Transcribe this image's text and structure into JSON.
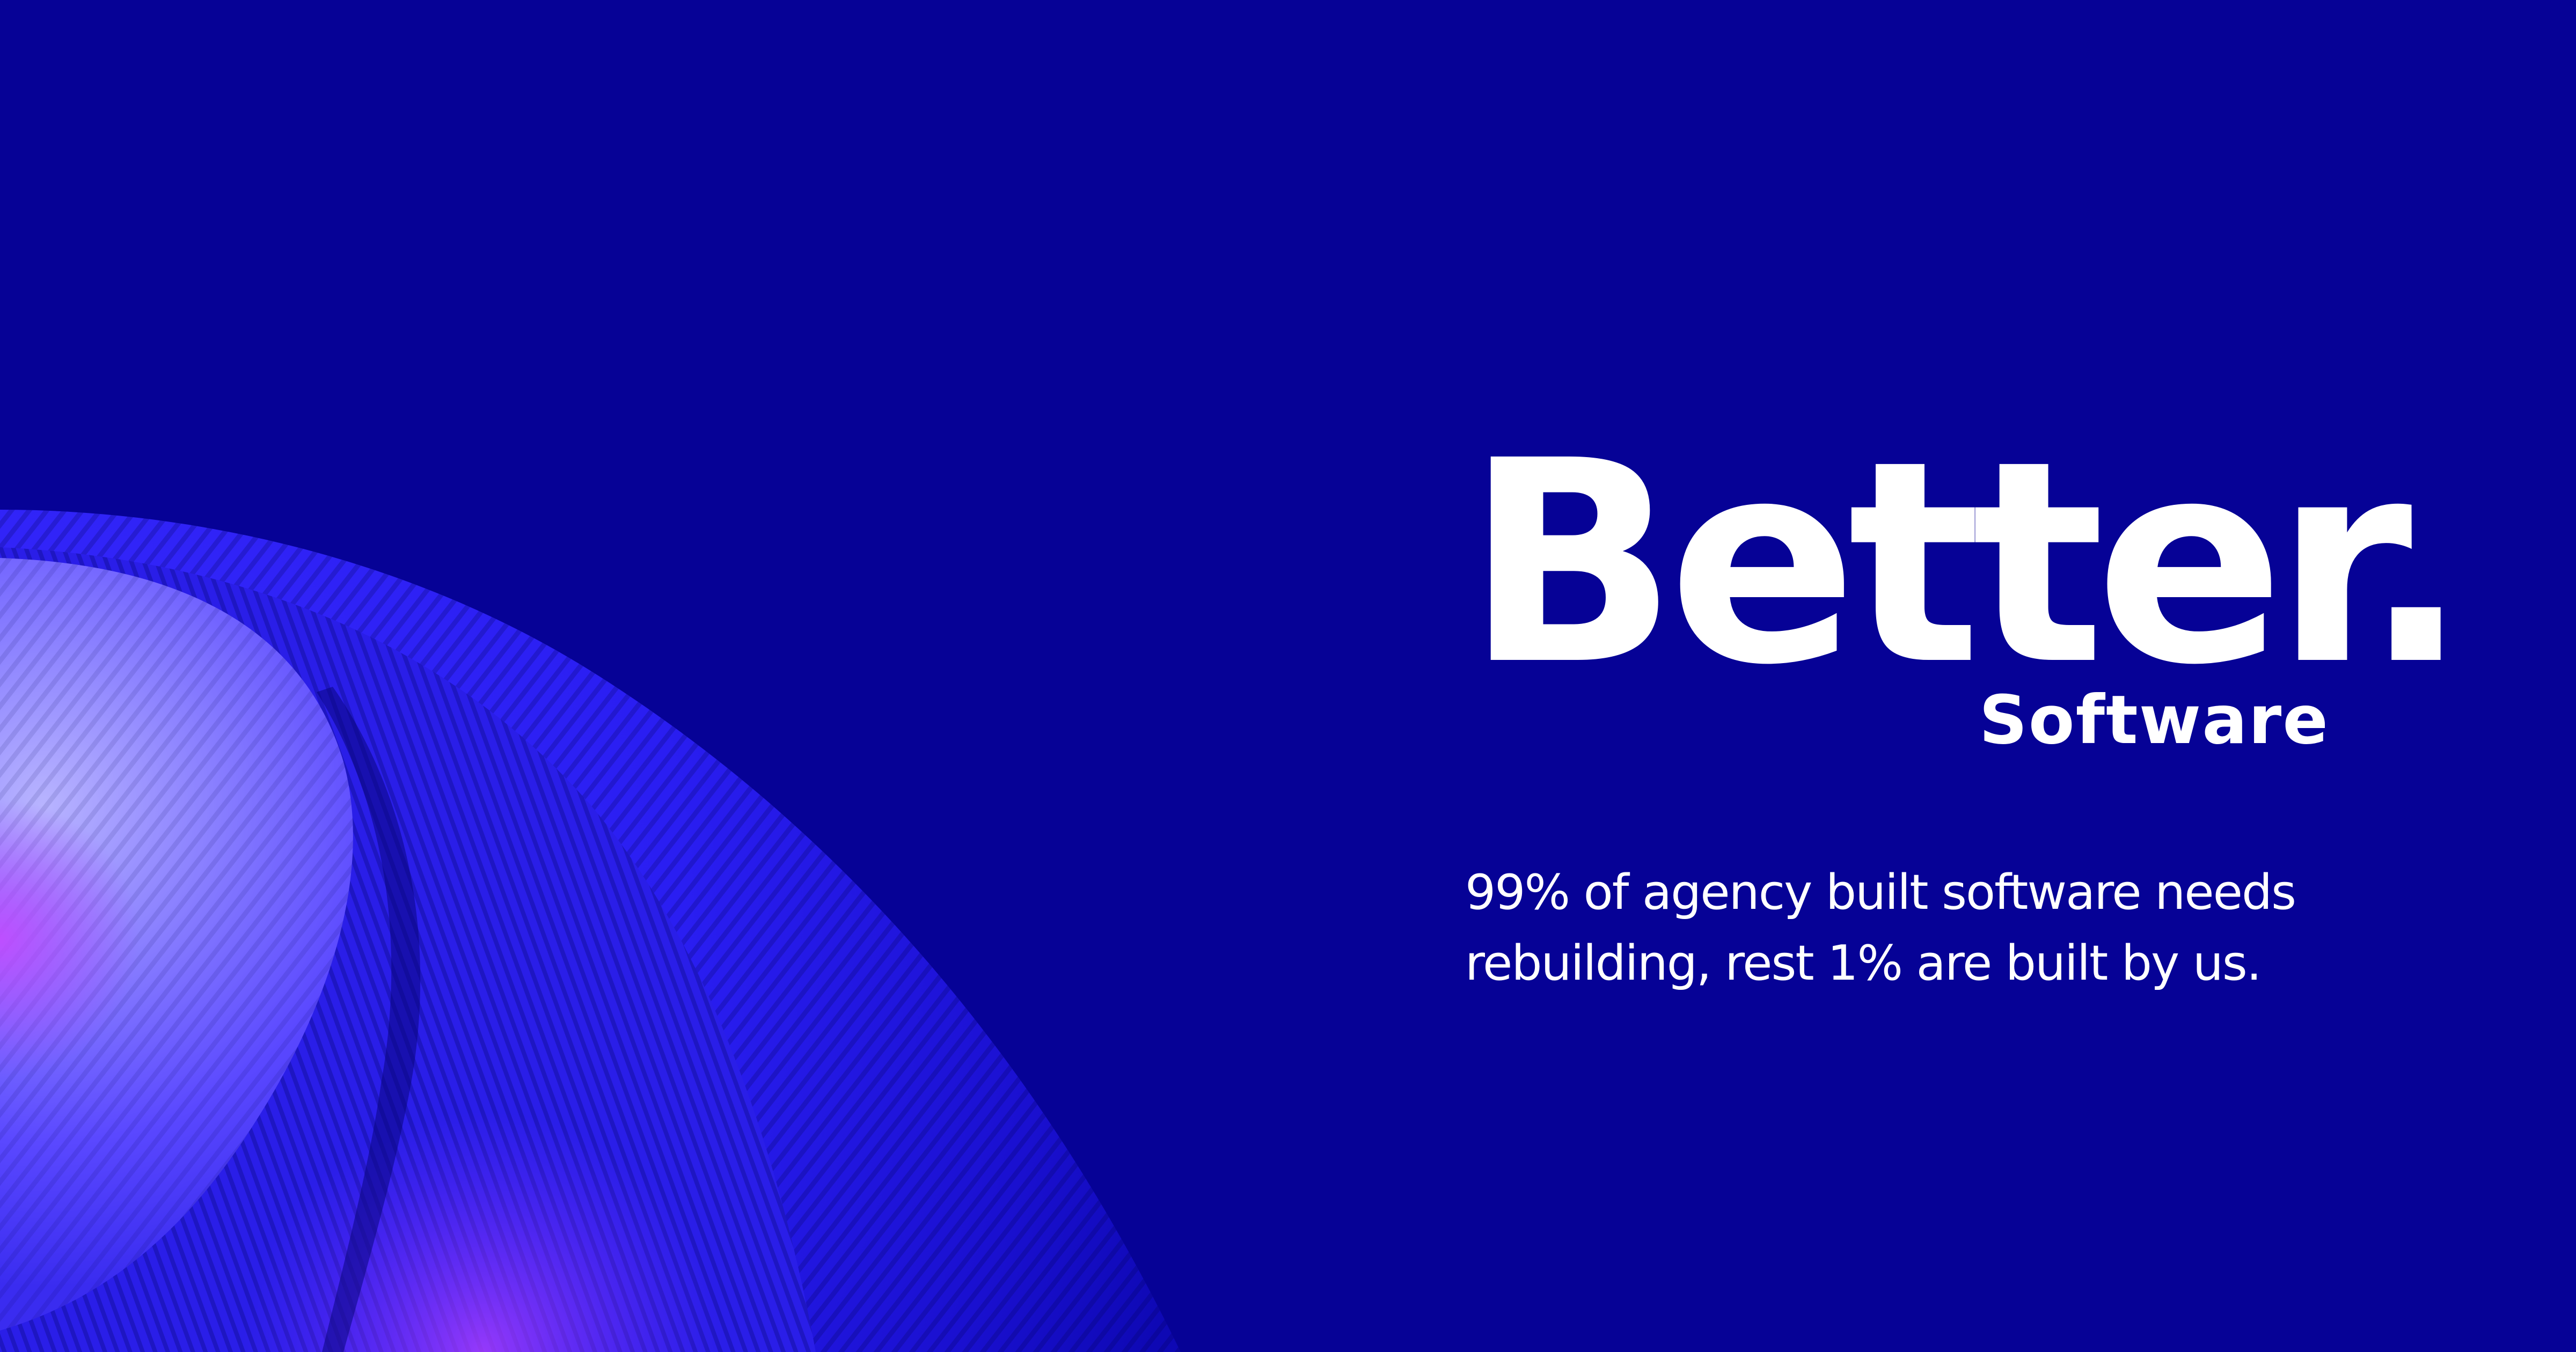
{
  "hero": {
    "headline": "Better.",
    "subheadline": "Software",
    "tagline": [
      "99% of agency built software needs",
      "rebuilding, rest 1% are built by us."
    ]
  },
  "colors": {
    "background": "#060296",
    "text": "#ffffff",
    "art_highlight": "#8a7dff",
    "art_accent": "#a23cff",
    "art_mid": "#2f22f0"
  }
}
